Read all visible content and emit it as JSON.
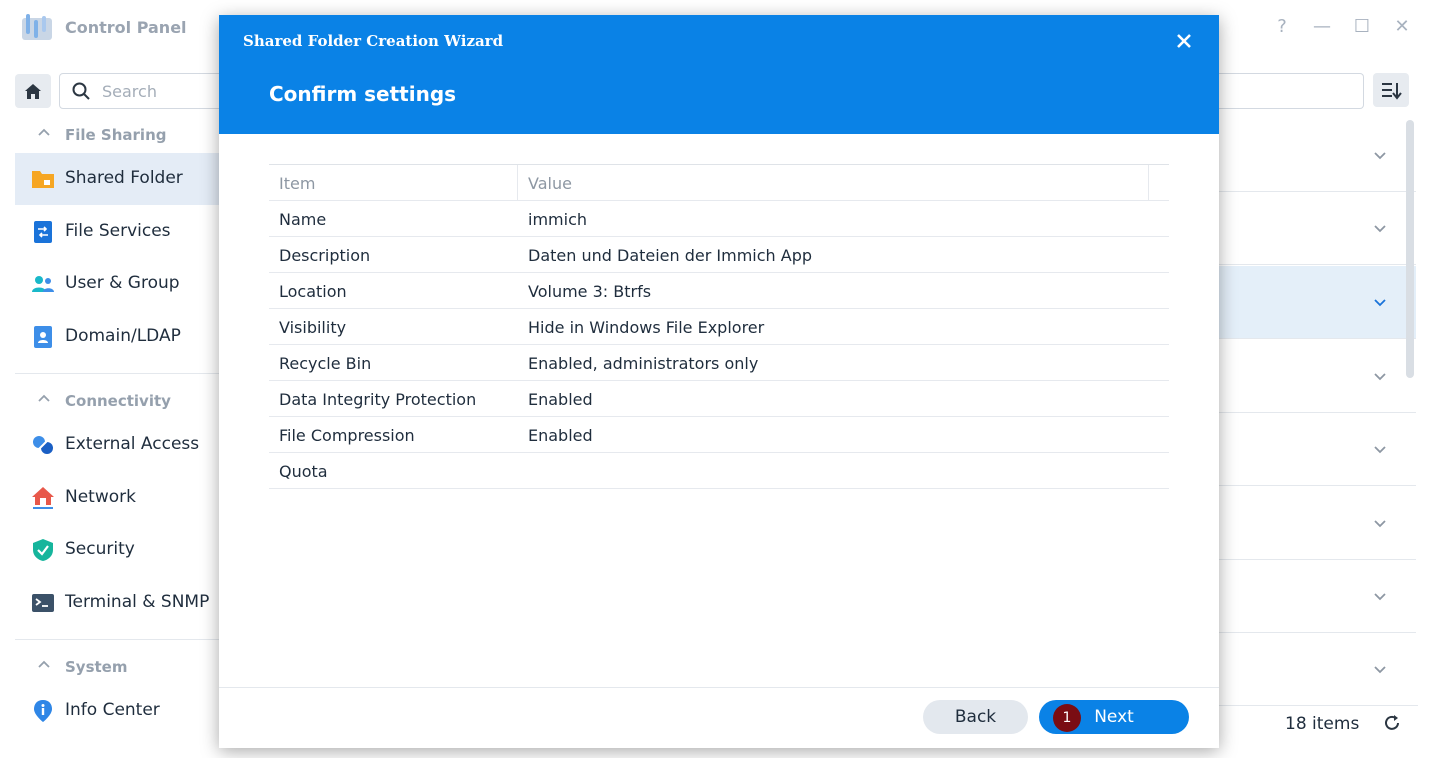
{
  "window": {
    "title": "Control Panel",
    "help_glyph": "?",
    "minimize_glyph": "—",
    "maximize_glyph": "☐",
    "close_glyph": "✕"
  },
  "search": {
    "placeholder": "Search"
  },
  "sidebar": {
    "sections": [
      {
        "label": "File Sharing",
        "items": [
          {
            "label": "Shared Folder",
            "icon": "folder-icon",
            "active": true
          },
          {
            "label": "File Services",
            "icon": "file-services-icon"
          },
          {
            "label": "User & Group",
            "icon": "users-icon"
          },
          {
            "label": "Domain/LDAP",
            "icon": "domain-icon"
          }
        ]
      },
      {
        "label": "Connectivity",
        "items": [
          {
            "label": "External Access",
            "icon": "external-access-icon"
          },
          {
            "label": "Network",
            "icon": "network-icon"
          },
          {
            "label": "Security",
            "icon": "shield-icon"
          },
          {
            "label": "Terminal & SNMP",
            "icon": "terminal-icon"
          }
        ]
      },
      {
        "label": "System",
        "items": [
          {
            "label": "Info Center",
            "icon": "info-icon"
          }
        ]
      }
    ]
  },
  "list": {
    "count_label": "18 items"
  },
  "wizard": {
    "title": "Shared Folder Creation Wizard",
    "step_title": "Confirm settings",
    "table": {
      "headers": [
        "Item",
        "Value"
      ],
      "rows": [
        [
          "Name",
          "immich"
        ],
        [
          "Description",
          "Daten und Dateien der Immich App"
        ],
        [
          "Location",
          "Volume 3: Btrfs"
        ],
        [
          "Visibility",
          "Hide in Windows File Explorer"
        ],
        [
          "Recycle Bin",
          "Enabled, administrators only"
        ],
        [
          "Data Integrity Protection",
          "Enabled"
        ],
        [
          "File Compression",
          "Enabled"
        ],
        [
          "Quota",
          ""
        ]
      ]
    },
    "back_label": "Back",
    "next_label": "Next",
    "badge": "1"
  },
  "colors": {
    "accent": "#0a82e6",
    "badge": "#7a0d13",
    "selected_row": "#e4eff9"
  }
}
